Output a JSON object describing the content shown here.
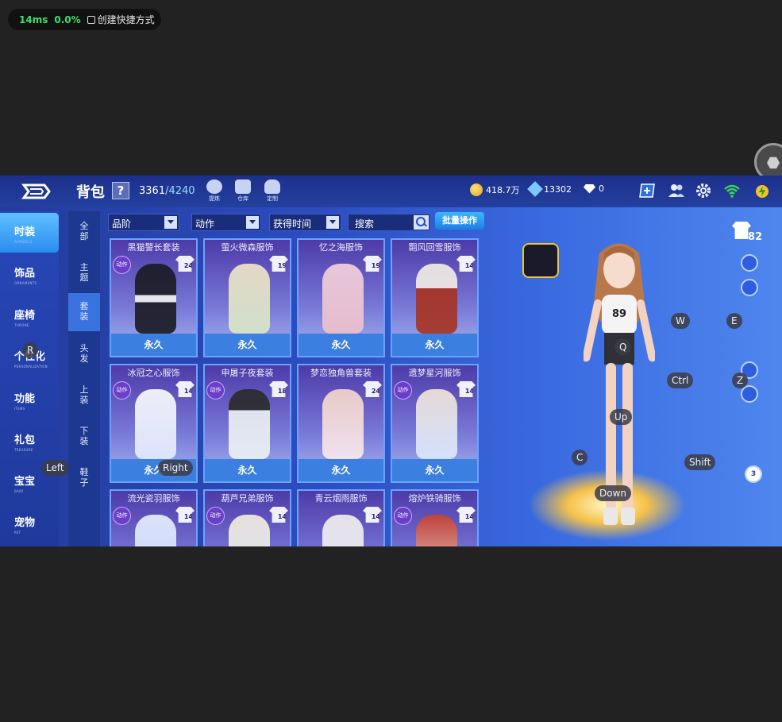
{
  "overlay_status": {
    "latency": "14ms",
    "loss": "0.0%",
    "shortcut_label": "创建快捷方式"
  },
  "header": {
    "title": "背包",
    "help": "?",
    "capacity_used": "3361",
    "capacity_max": "/4240",
    "top_icons": [
      "提炼",
      "仓库",
      "定制"
    ],
    "coins": "418.7万",
    "crystals": "13302",
    "diamonds": "0"
  },
  "main_nav": [
    {
      "cn": "时装",
      "en": "APPARELS"
    },
    {
      "cn": "饰品",
      "en": "ORNAMENTS"
    },
    {
      "cn": "座椅",
      "en": "THRONE"
    },
    {
      "cn": "个性化",
      "en": "PERSONALIZATION"
    },
    {
      "cn": "功能",
      "en": "ITEMS"
    },
    {
      "cn": "礼包",
      "en": "TREASURE"
    },
    {
      "cn": "宝宝",
      "en": "BABY"
    },
    {
      "cn": "宠物",
      "en": "PET"
    }
  ],
  "sub_nav": [
    "全部",
    "主题",
    "套装",
    "头发",
    "上装",
    "下装",
    "鞋子"
  ],
  "filters": {
    "grade": "品阶",
    "action": "动作",
    "obtain_time": "获得时间",
    "search_placeholder": "搜索",
    "batch": "批量操作"
  },
  "outfits": [
    {
      "name": "黑猫警长套装",
      "level": "24",
      "time": "永久"
    },
    {
      "name": "萤火微森服饰",
      "level": "19",
      "time": "永久"
    },
    {
      "name": "忆之海服饰",
      "level": "19",
      "time": "永久"
    },
    {
      "name": "翾风回雪服饰",
      "level": "14",
      "time": "永久"
    },
    {
      "name": "冰冠之心服饰",
      "level": "14",
      "time": "永久"
    },
    {
      "name": "申屠子夜套装",
      "level": "18",
      "time": "永久"
    },
    {
      "name": "梦恋独角兽套装",
      "level": "24",
      "time": "永久"
    },
    {
      "name": "遗梦星河服饰",
      "level": "14",
      "time": "永久"
    },
    {
      "name": "流光瓷羽服饰",
      "level": "14",
      "time": ""
    },
    {
      "name": "葫芦兄弟服饰",
      "level": "14",
      "time": ""
    },
    {
      "name": "青云烟雨服饰",
      "level": "14",
      "time": ""
    },
    {
      "name": "熔炉铁骑服饰",
      "level": "14",
      "time": ""
    }
  ],
  "action_badge": "动作",
  "outfit_count": "82",
  "tool_badge": "3",
  "key_labels": {
    "R": "R",
    "W": "W",
    "E": "E",
    "Q": "Q",
    "Ctrl": "Ctrl",
    "Z": "Z",
    "Up": "Up",
    "C": "C",
    "Shift": "Shift",
    "Down": "Down",
    "Left": "Left",
    "Right": "Right"
  },
  "colors": {
    "accent": "#3b7fe0",
    "nav_active": "#2a8cf0",
    "background": "#222222"
  }
}
